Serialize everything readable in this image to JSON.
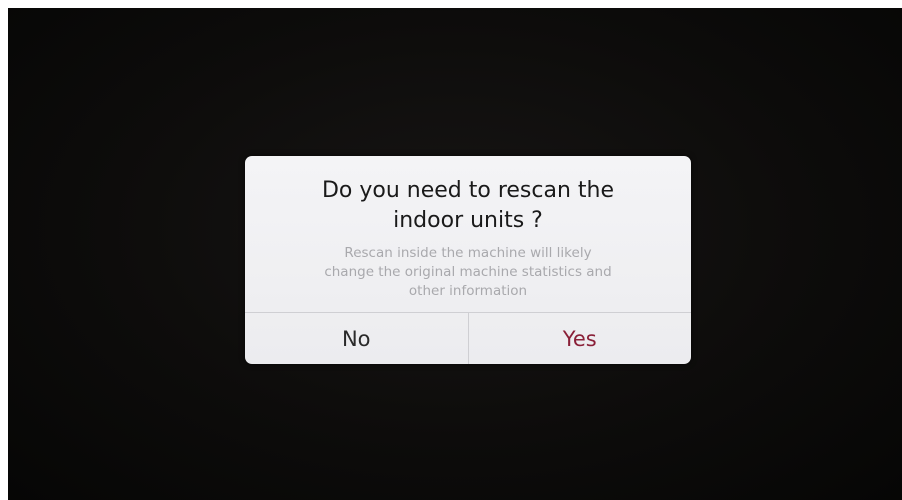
{
  "dialog": {
    "title": "Do you need to rescan the\nindoor units ?",
    "message": "Rescan inside the machine will likely\nchange the original machine statistics and\nother information",
    "buttons": {
      "no_label": "No",
      "yes_label": "Yes"
    }
  },
  "colors": {
    "background": "#0d0c0b",
    "dialog_background": "#f0f0f2",
    "confirm_text": "#8a2038",
    "message_text": "#a9a9ad"
  }
}
